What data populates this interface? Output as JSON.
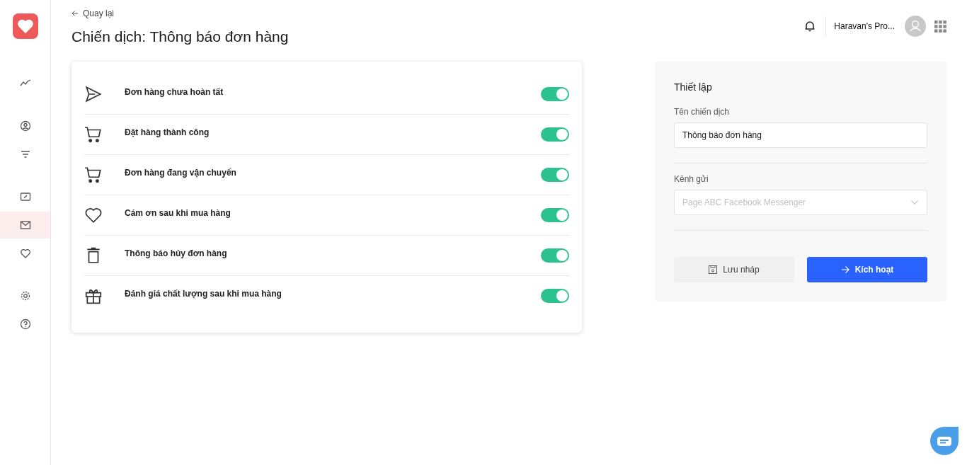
{
  "sidebar": {
    "items": [
      {
        "kind": "chart",
        "selected": false
      },
      {
        "kind": "user",
        "selected": false
      },
      {
        "kind": "filter",
        "selected": false
      },
      {
        "kind": "ticket",
        "selected": false
      },
      {
        "kind": "mail",
        "selected": true
      },
      {
        "kind": "heart",
        "selected": false
      },
      {
        "kind": "gear",
        "selected": false
      },
      {
        "kind": "help",
        "selected": false
      }
    ]
  },
  "back_link": "Quay lại",
  "title": "Chiến dịch: Thông báo đơn hàng",
  "header": {
    "account_name": "Haravan's Pro..."
  },
  "campaigns": [
    {
      "kind": "send",
      "label": "Đơn hàng chưa hoàn tất",
      "on": true
    },
    {
      "kind": "cart",
      "label": "Đặt hàng thành công",
      "on": true
    },
    {
      "kind": "cart",
      "label": "Đơn hàng đang vận chuyển",
      "on": true
    },
    {
      "kind": "heart",
      "label": "Cám ơn sau khi mua hàng",
      "on": true
    },
    {
      "kind": "trash",
      "label": "Thông báo hủy đơn hàng",
      "on": true
    },
    {
      "kind": "gift",
      "label": "Đánh giá chất lượng sau khi mua hàng",
      "on": true
    }
  ],
  "settings": {
    "heading": "Thiết lập",
    "name_label": "Tên chiến dịch",
    "name_value": "Thông báo đơn hàng",
    "channel_label": "Kênh gửi",
    "channel_placeholder": "Page ABC Facebook Messenger",
    "draft_button": "Lưu nháp",
    "activate_button": "Kích hoạt"
  }
}
